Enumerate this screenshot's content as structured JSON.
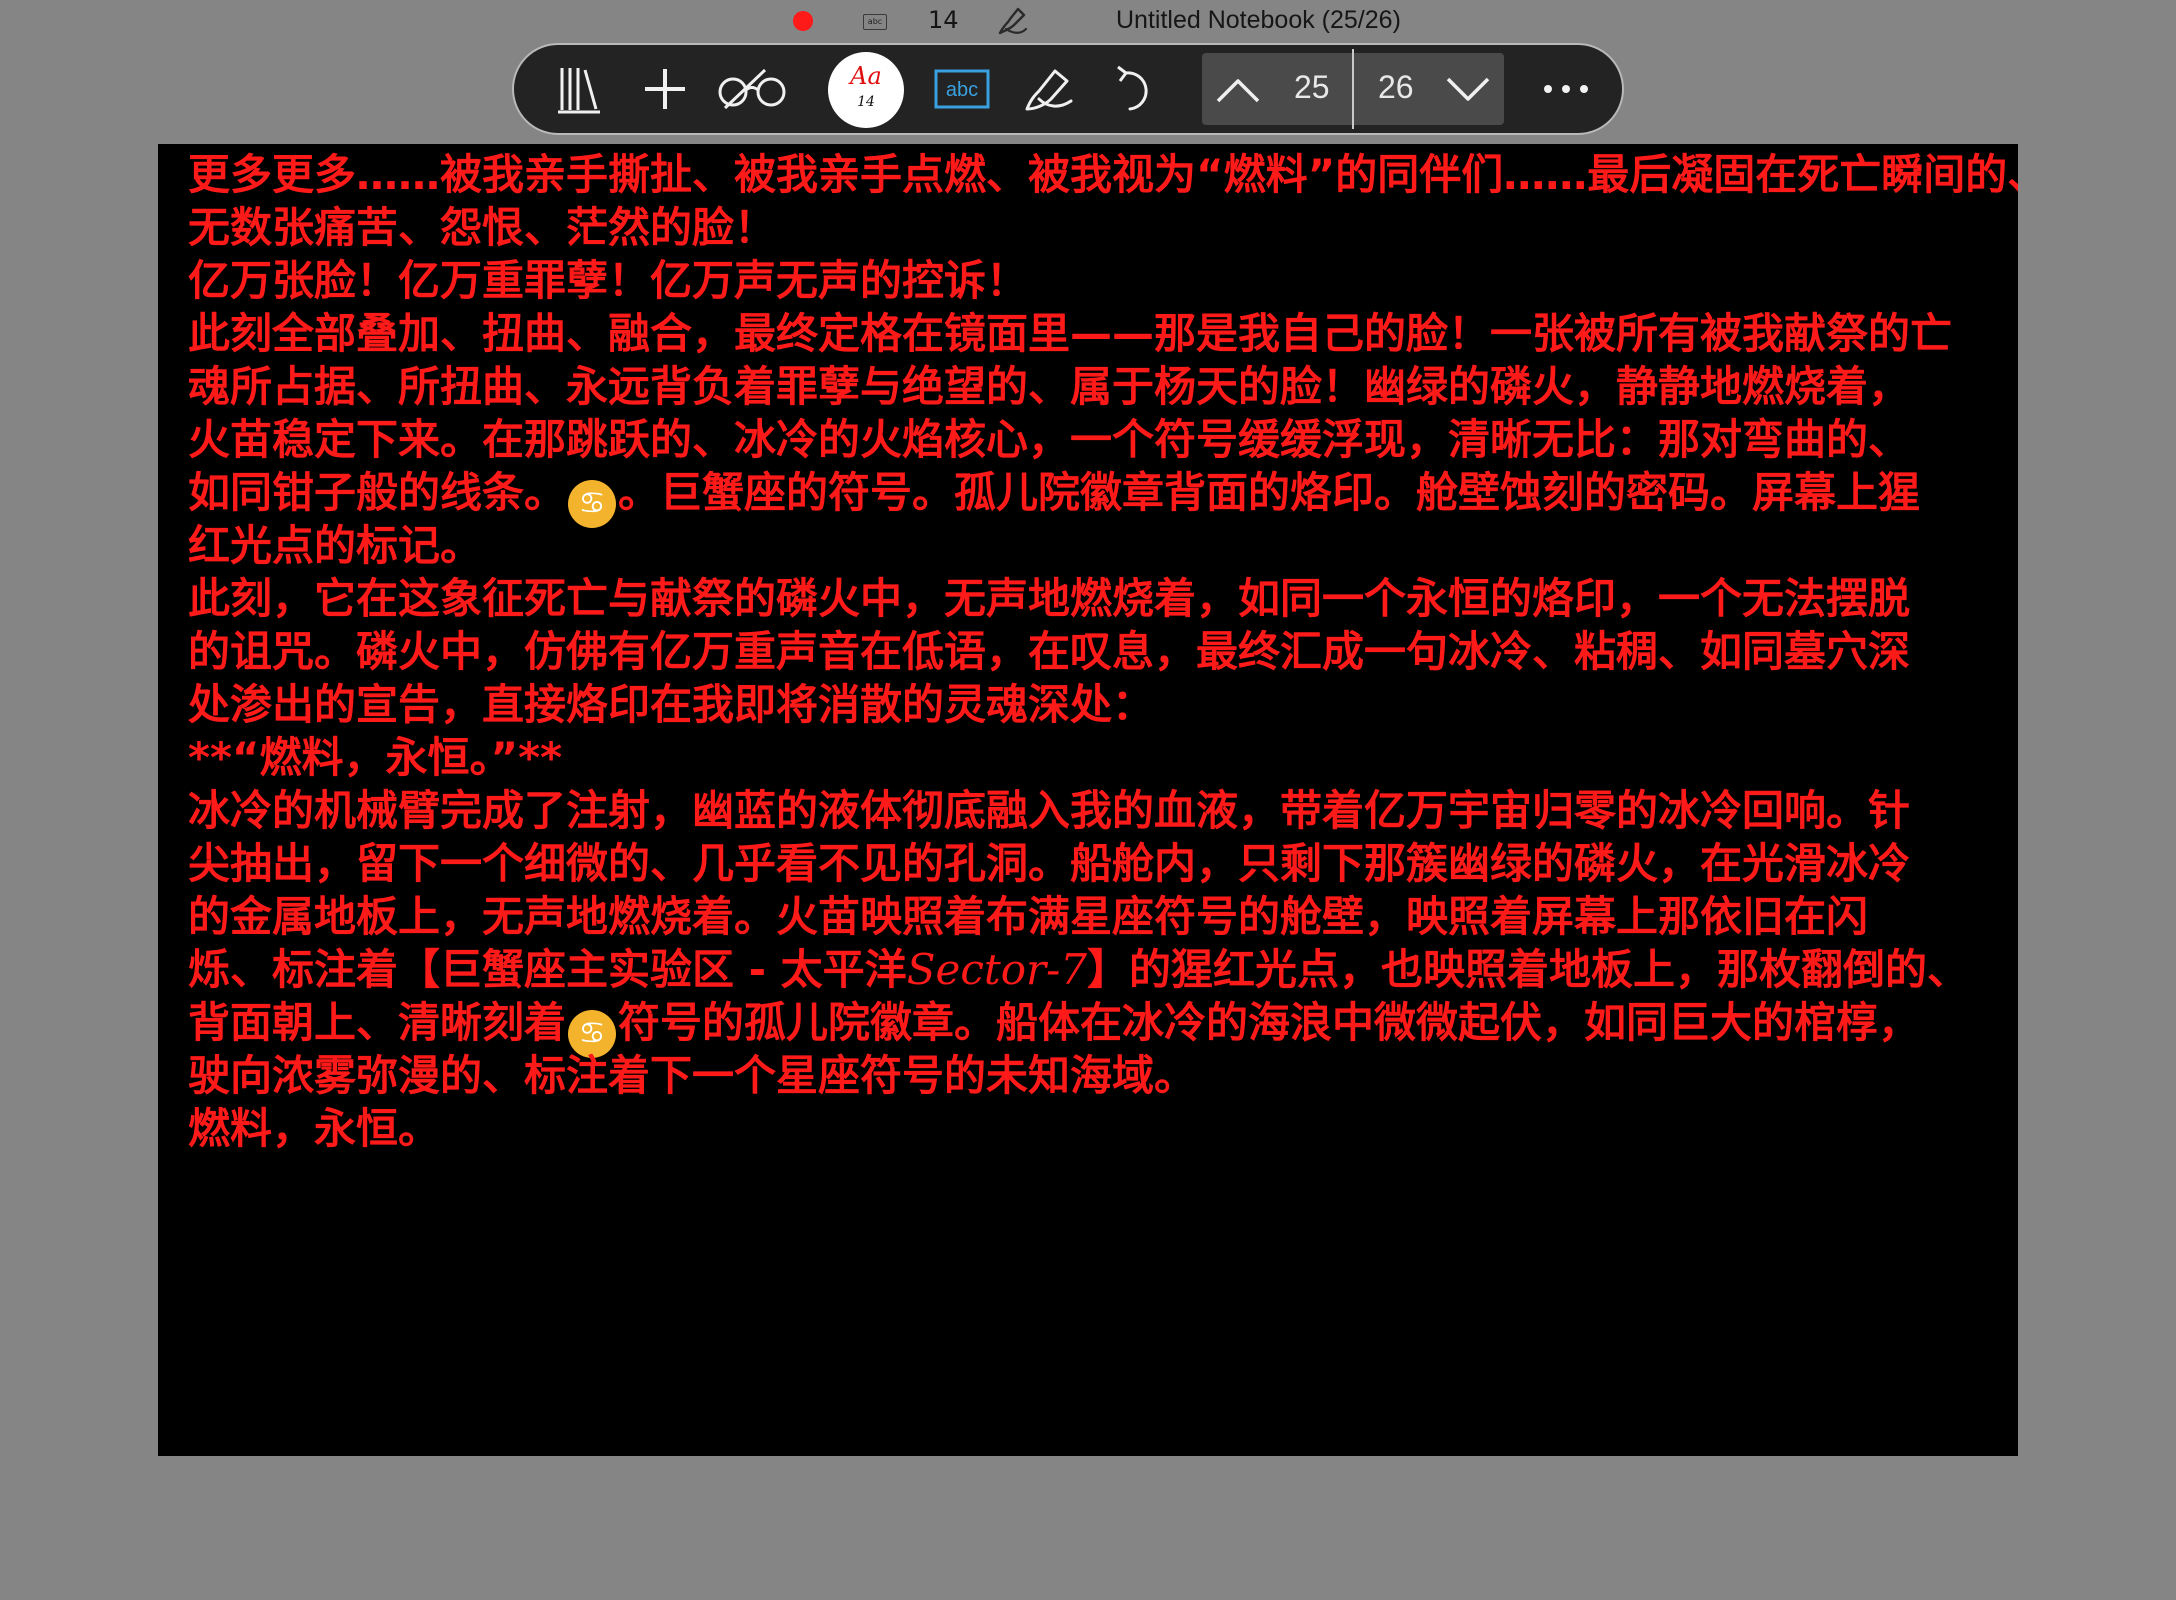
{
  "status": {
    "font_size": "14",
    "title": "Untitled Notebook (25/26)",
    "keyboard_icon_label": "abc"
  },
  "toolbar": {
    "font_button_aa": "Aa",
    "font_button_size": "14",
    "text_mode_label": "abc",
    "current_page": "25",
    "total_pages": "26"
  },
  "colors": {
    "text": "#ff1a1a",
    "page_background": "#000000",
    "toolbar_background": "#232323",
    "app_background": "#858585"
  },
  "page": {
    "lines": [
      [
        "更多更多……被我亲手撕扯、被我亲手点燃、被我视为“燃料”的同伴们……最后凝固在死亡瞬间的、"
      ],
      [
        "无数张痛苦、怨恨、茫然的脸！"
      ],
      [
        "亿万张脸！亿万重罪孽！亿万声无声的控诉！"
      ],
      [
        "此刻全部叠加、扭曲、融合，最终定格在镜面里——那是我自己的脸！一张被所有被我献祭的亡"
      ],
      [
        "魂所占据、所扭曲、永远背负着罪孽与绝望的、属于杨天的脸！幽绿的磷火，静静地燃烧着，"
      ],
      [
        "火苗稳定下来。在那跳跃的、冰冷的火焰核心，一个符号缓缓浮现，清晰无比：那对弯曲的、"
      ],
      [
        "如同钳子般的线条。",
        "。巨蟹座的符号。孤儿院徽章背面的烙印。舱壁蚀刻的密码。屏幕上猩"
      ],
      [
        "红光点的标记。"
      ],
      [
        "此刻，它在这象征死亡与献祭的磷火中，无声地燃烧着，如同一个永恒的烙印，一个无法摆脱"
      ],
      [
        "的诅咒。磷火中，仿佛有亿万重声音在低语，在叹息，最终汇成一句冰冷、粘稠、如同墓穴深"
      ],
      [
        "处渗出的宣告，直接烙印在我即将消散的灵魂深处："
      ],
      [
        "**“燃料，永恒。”**"
      ],
      [
        "冰冷的机械臂完成了注射，幽蓝的液体彻底融入我的血液，带着亿万宇宙归零的冰冷回响。针"
      ],
      [
        "尖抽出，留下一个细微的、几乎看不见的孔洞。船舱内，只剩下那簇幽绿的磷火，在光滑冰冷"
      ],
      [
        "的金属地板上，无声地燃烧着。火苗映照着布满星座符号的舱壁，映照着屏幕上那依旧在闪"
      ],
      [
        "烁、标注着【巨蟹座主实验区 - 太平洋",
        "Sector-7",
        "】的猩红光点，也映照着地板上，那枚翻倒的、"
      ],
      [
        "背面朝上、清晰刻着",
        "符号的孤儿院徽章。船体在冰冷的海浪中微微起伏，如同巨大的棺椁，"
      ],
      [
        "驶向浓雾弥漫的、标注着下一个星座符号的未知海域。"
      ],
      [
        "燃料，永恒。"
      ]
    ]
  }
}
